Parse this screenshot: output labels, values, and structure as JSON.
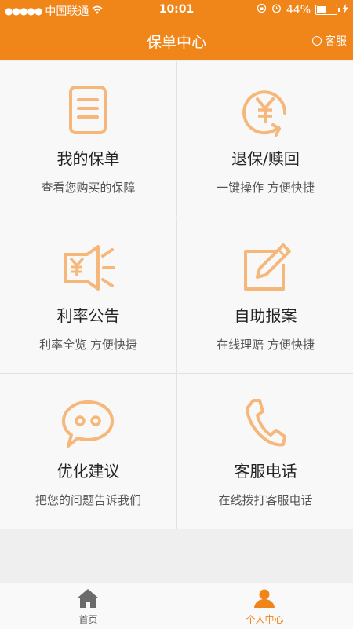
{
  "status_bar": {
    "carrier": "中国联通",
    "time": "10:01",
    "battery": "44%",
    "battery_level": 0.44
  },
  "nav": {
    "title": "保单中心",
    "service_label": "客服"
  },
  "menu": [
    {
      "label": "我的保单",
      "sub": "查看您购买的保障",
      "icon": "document-icon"
    },
    {
      "label": "退保/赎回",
      "sub": "一键操作 方便快捷",
      "icon": "yen-refresh-icon"
    },
    {
      "label": "利率公告",
      "sub": "利率全览 方便快捷",
      "icon": "megaphone-yen-icon"
    },
    {
      "label": "自助报案",
      "sub": "在线理赔 方便快捷",
      "icon": "edit-icon"
    },
    {
      "label": "优化建议",
      "sub": "把您的问题告诉我们",
      "icon": "chat-bubble-icon"
    },
    {
      "label": "客服电话",
      "sub": "在线拨打客服电话",
      "icon": "phone-icon"
    }
  ],
  "tabs": [
    {
      "label": "首页",
      "icon": "home-icon",
      "active": false
    },
    {
      "label": "个人中心",
      "icon": "person-icon",
      "active": true
    }
  ],
  "colors": {
    "brand": "#f08519",
    "icon": "#f5b77a"
  }
}
